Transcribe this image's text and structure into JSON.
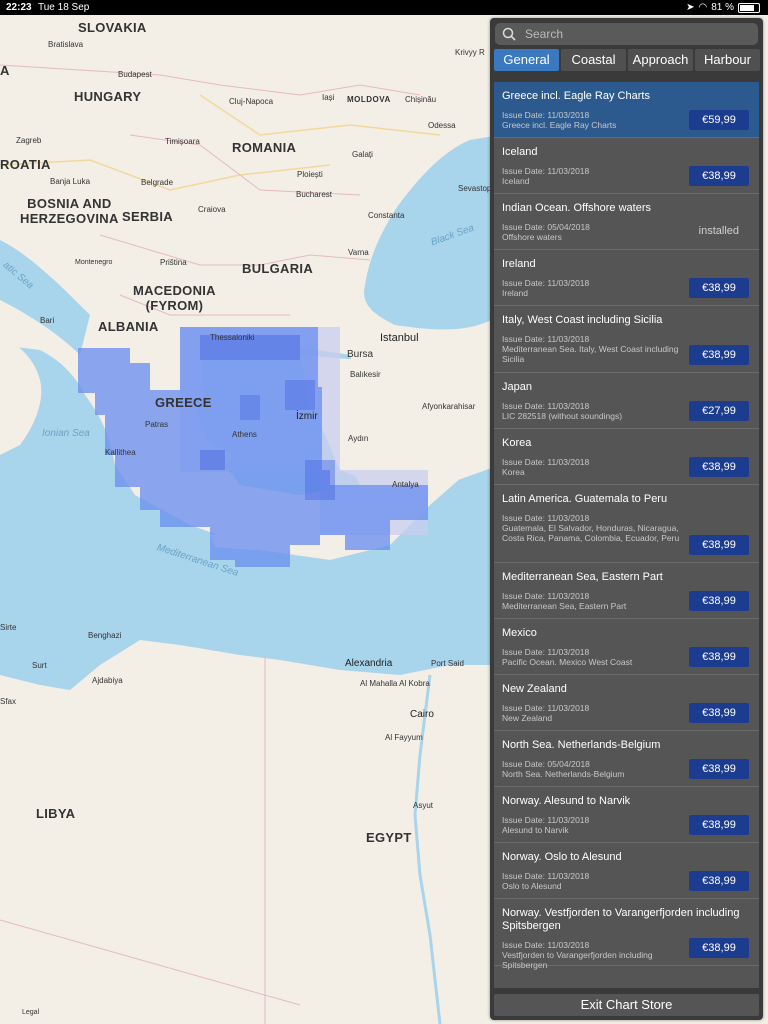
{
  "status_bar": {
    "time": "22:23",
    "date": "Tue 18 Sep",
    "battery": "81 %"
  },
  "map": {
    "countries": [
      {
        "id": "slovakia",
        "label": "SLOVAKIA"
      },
      {
        "id": "hungary",
        "label": "HUNGARY"
      },
      {
        "id": "romania",
        "label": "ROMANIA"
      },
      {
        "id": "moldova",
        "label": "MOLDOVA"
      },
      {
        "id": "croatia",
        "label": "ROATIA"
      },
      {
        "id": "bosnia",
        "label": "BOSNIA AND\nHERZEGOVINA"
      },
      {
        "id": "serbia",
        "label": "SERBIA"
      },
      {
        "id": "bulgaria",
        "label": "BULGARIA"
      },
      {
        "id": "macedonia",
        "label": "MACEDONIA\n(FYROM)"
      },
      {
        "id": "albania",
        "label": "ALBANIA"
      },
      {
        "id": "greece",
        "label": "GREECE"
      },
      {
        "id": "libya",
        "label": "LIBYA"
      },
      {
        "id": "egypt",
        "label": "EGYPT"
      },
      {
        "id": "a",
        "label": "A"
      }
    ],
    "cities": [
      "Bratislava",
      "Budapest",
      "Zagreb",
      "Timișoara",
      "Cluj-Napoca",
      "Iași",
      "Chișinău",
      "Odessa",
      "Krivyy R",
      "Banja Luka",
      "Belgrade",
      "Ploiești",
      "Galați",
      "Bucharest",
      "Craiova",
      "Constanta",
      "Sevastop",
      "Montenegro",
      "Priština",
      "Varna",
      "Bari",
      "Thessaloniki",
      "Bursa",
      "Istanbul",
      "Balıkesir",
      "Patras",
      "Athens",
      "İzmir",
      "Afyonkarahisar",
      "Aydın",
      "Kallithea",
      "Antalya",
      "Benghazi",
      "Sirte",
      "Sfax",
      "Surt",
      "Ajdabiya",
      "Alexandria",
      "Port Said",
      "Al Mahalla Al Kobra",
      "Cairo",
      "Al Fayyum",
      "Asyut"
    ],
    "seas": [
      "Black Sea",
      "Ionian Sea",
      "Mediterranean Sea",
      "atic Sea"
    ],
    "legal": "Legal",
    "colors": {
      "land": "#f3efe6",
      "water": "#a8d4ec",
      "coverage": "#6b8ff0",
      "coverage_light": "#c9cdf0"
    }
  },
  "search": {
    "placeholder": "Search",
    "value": ""
  },
  "tabs": [
    {
      "label": "General",
      "active": true
    },
    {
      "label": "Coastal",
      "active": false
    },
    {
      "label": "Approach",
      "active": false
    },
    {
      "label": "Harbour",
      "active": false
    }
  ],
  "charts": [
    {
      "title": "Greece incl. Eagle Ray Charts",
      "issue": "Issue Date: 11/03/2018",
      "desc": "Greece incl. Eagle Ray Charts",
      "price": "€59,99",
      "selected": true
    },
    {
      "title": "Iceland",
      "issue": "Issue Date: 11/03/2018",
      "desc": "Iceland",
      "price": "€38,99"
    },
    {
      "title": "Indian Ocean. Offshore waters",
      "issue": "Issue Date: 05/04/2018",
      "desc": "Offshore waters",
      "status": "installed"
    },
    {
      "title": "Ireland",
      "issue": "Issue Date: 11/03/2018",
      "desc": "Ireland",
      "price": "€38,99"
    },
    {
      "title": "Italy, West Coast including Sicilia",
      "issue": "Issue Date: 11/03/2018",
      "desc": "Mediterranean Sea. Italy, West Coast including Sicilia",
      "price": "€38,99"
    },
    {
      "title": "Japan",
      "issue": "Issue Date: 11/03/2018",
      "desc": "LIC 282518 (without soundings)",
      "price": "€27,99"
    },
    {
      "title": "Korea",
      "issue": "Issue Date: 11/03/2018",
      "desc": "Korea",
      "price": "€38,99"
    },
    {
      "title": "Latin America. Guatemala to Peru",
      "issue": "Issue Date: 11/03/2018",
      "desc": "Guatemala, El Salvador, Honduras, Nicaragua, Costa Rica, Panama, Colombia, Ecuador, Peru",
      "price": "€38,99"
    },
    {
      "title": "Mediterranean Sea, Eastern Part",
      "issue": "Issue Date: 11/03/2018",
      "desc": "Mediterranean Sea, Eastern Part",
      "price": "€38,99"
    },
    {
      "title": "Mexico",
      "issue": "Issue Date: 11/03/2018",
      "desc": "Pacific Ocean. Mexico West Coast",
      "price": "€38,99"
    },
    {
      "title": "New Zealand",
      "issue": "Issue Date: 11/03/2018",
      "desc": "New Zealand",
      "price": "€38,99"
    },
    {
      "title": "North Sea. Netherlands-Belgium",
      "issue": "Issue Date: 05/04/2018",
      "desc": "North Sea. Netherlands-Belgium",
      "price": "€38,99"
    },
    {
      "title": "Norway. Alesund to Narvik",
      "issue": "Issue Date: 11/03/2018",
      "desc": "Alesund to Narvik",
      "price": "€38,99"
    },
    {
      "title": "Norway. Oslo to Alesund",
      "issue": "Issue Date: 11/03/2018",
      "desc": "Oslo to Alesund",
      "price": "€38,99"
    },
    {
      "title": "Norway. Vestfjorden to Varangerfjorden including Spitsbergen",
      "issue": "Issue Date: 11/03/2018",
      "desc": "Vestfjorden to Varangerfjorden including Spitsbergen",
      "price": "€38,99"
    }
  ],
  "exit_label": "Exit Chart Store"
}
